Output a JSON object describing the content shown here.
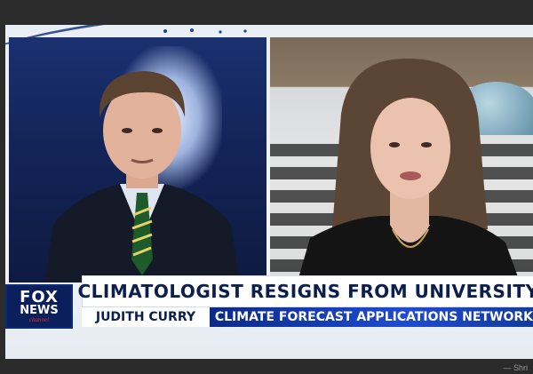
{
  "lower_third": {
    "headline": "CLIMATOLOGIST RESIGNS FROM UNIVERSITY",
    "guest_name": "JUDITH CURRY",
    "guest_affiliation": "CLIMATE FORECAST APPLICATIONS NETWORK"
  },
  "logo": {
    "line1": "FOX",
    "line2": "NEWS",
    "line3": "channel"
  },
  "corner_label": "— Shri",
  "colors": {
    "navy": "#0b1f4d",
    "blue_bar": "#1f4bd1",
    "background": "#e9eef5"
  }
}
